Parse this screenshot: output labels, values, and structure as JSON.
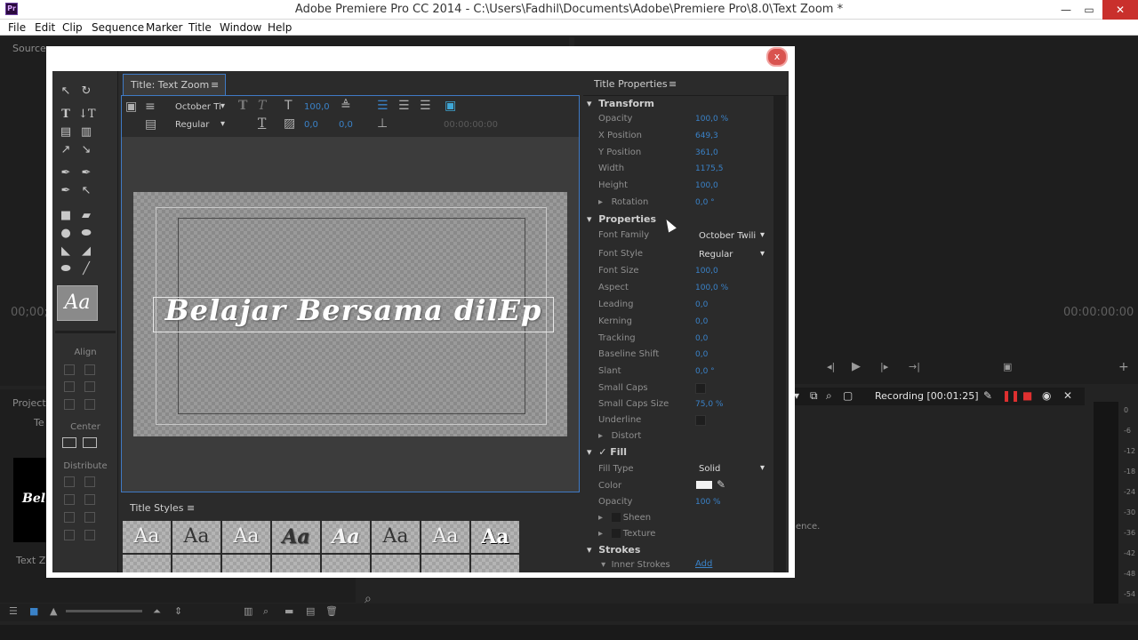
{
  "window": {
    "app_icon_label": "Pr",
    "title": "Adobe Premiere Pro CC 2014 - C:\\Users\\Fadhil\\Documents\\Adobe\\Premiere Pro\\8.0\\Text Zoom *",
    "minimize": "—",
    "maximize": "▭",
    "close": "✕"
  },
  "menu": [
    "File",
    "Edit",
    "Clip",
    "Sequence",
    "Marker",
    "Title",
    "Window",
    "Help"
  ],
  "background": {
    "source_label": "Source:",
    "left_time": "00;00;",
    "right_time": "00:00:00:00",
    "project_label": "Project:",
    "project_tab": "Te",
    "clip_name": "Text Zoo",
    "clip_thumb_text": "Bel",
    "partial_message": "ence."
  },
  "dialog": {
    "close_label": "x",
    "title_tab": "Title: Text Zoom",
    "toolbar": {
      "font_family": "October Ti",
      "font_style": "Regular",
      "font_size": "100,0",
      "kerning": "0,0",
      "leading": "0,0",
      "timecode": "00:00:00:00"
    },
    "canvas_text": "Belajar Bersama dilEp",
    "tools": {
      "align_label": "Align",
      "center_label": "Center",
      "distribute_label": "Distribute",
      "style_preview": "Aa"
    },
    "title_styles_tab": "Title Styles",
    "style_swatches": [
      "Aa",
      "Aa",
      "Aa",
      "Aa",
      "Aa",
      "Aa",
      "Aa",
      "Aa"
    ]
  },
  "properties": {
    "header": "Title Properties",
    "sections": {
      "transform": "Transform",
      "properties": "Properties",
      "fill": "Fill",
      "strokes": "Strokes"
    },
    "transform": {
      "opacity": {
        "label": "Opacity",
        "value": "100,0 %"
      },
      "x_position": {
        "label": "X Position",
        "value": "649,3"
      },
      "y_position": {
        "label": "Y Position",
        "value": "361,0"
      },
      "width": {
        "label": "Width",
        "value": "1175,5"
      },
      "height": {
        "label": "Height",
        "value": "100,0"
      },
      "rotation": {
        "label": "Rotation",
        "value": "0,0 °"
      }
    },
    "props": {
      "font_family": {
        "label": "Font Family",
        "value": "October Twili"
      },
      "font_style": {
        "label": "Font Style",
        "value": "Regular"
      },
      "font_size": {
        "label": "Font Size",
        "value": "100,0"
      },
      "aspect": {
        "label": "Aspect",
        "value": "100,0 %"
      },
      "leading": {
        "label": "Leading",
        "value": "0,0"
      },
      "kerning": {
        "label": "Kerning",
        "value": "0,0"
      },
      "tracking": {
        "label": "Tracking",
        "value": "0,0"
      },
      "baseline_shift": {
        "label": "Baseline Shift",
        "value": "0,0"
      },
      "slant": {
        "label": "Slant",
        "value": "0,0 °"
      },
      "small_caps": {
        "label": "Small Caps"
      },
      "small_caps_size": {
        "label": "Small Caps Size",
        "value": "75,0 %"
      },
      "underline": {
        "label": "Underline"
      },
      "distort": {
        "label": "Distort"
      }
    },
    "fill": {
      "fill_type": {
        "label": "Fill Type",
        "value": "Solid"
      },
      "color": {
        "label": "Color",
        "value": "#f2f2f2"
      },
      "opacity": {
        "label": "Opacity",
        "value": "100 %"
      },
      "sheen": {
        "label": "Sheen"
      },
      "texture": {
        "label": "Texture"
      }
    },
    "strokes": {
      "inner_strokes": {
        "label": "Inner Strokes",
        "action": "Add"
      }
    }
  },
  "recording": {
    "label": "Recording [00:01:25]"
  },
  "meter_ticks": [
    "0",
    "-6",
    "-12",
    "-18",
    "-24",
    "-30",
    "-36",
    "-42",
    "-48",
    "-54"
  ],
  "colors": {
    "accent": "#3a82c8",
    "panel_border": "#3f7ac5",
    "close_red": "#d9534f"
  }
}
